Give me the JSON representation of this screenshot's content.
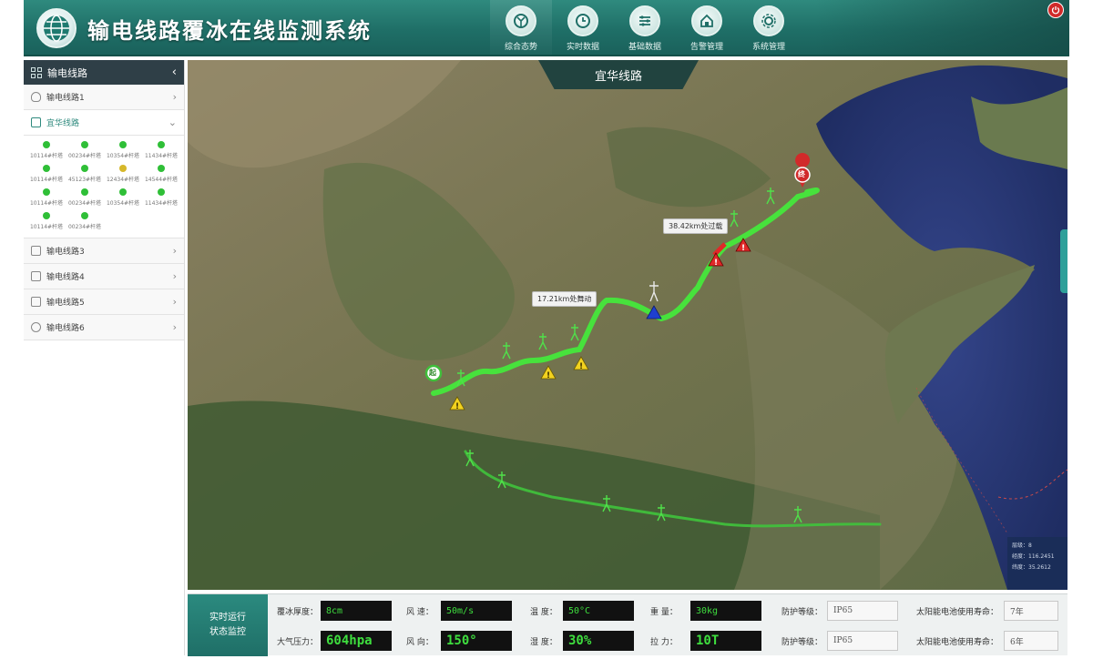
{
  "app": {
    "title": "输电线路覆冰在线监测系统"
  },
  "nav": [
    {
      "label": "综合态势",
      "icon": "dashboard-icon",
      "active": true
    },
    {
      "label": "实时数据",
      "icon": "realtime-data-icon",
      "active": false
    },
    {
      "label": "基础数据",
      "icon": "base-data-icon",
      "active": false
    },
    {
      "label": "告警管理",
      "icon": "alarm-house-icon",
      "active": false
    },
    {
      "label": "系统管理",
      "icon": "gear-icon",
      "active": false
    }
  ],
  "sidebar": {
    "header": "输电线路",
    "lines": [
      {
        "label": "输电线路1",
        "icon": "shield-icon"
      },
      {
        "label": "宜华线路",
        "icon": "calendar-icon",
        "expanded": true
      },
      {
        "label": "输电线路3",
        "icon": "calendar-icon"
      },
      {
        "label": "输电线路4",
        "icon": "document-icon"
      },
      {
        "label": "输电线路5",
        "icon": "document-icon"
      },
      {
        "label": "输电线路6",
        "icon": "share-icon"
      }
    ],
    "towers": [
      {
        "label": "10114#杆塔",
        "status": "normal"
      },
      {
        "label": "00234#杆塔",
        "status": "normal"
      },
      {
        "label": "10354#杆塔",
        "status": "normal"
      },
      {
        "label": "11434#杆塔",
        "status": "normal"
      },
      {
        "label": "10114#杆塔",
        "status": "normal"
      },
      {
        "label": "45123#杆塔",
        "status": "normal"
      },
      {
        "label": "12434#杆塔",
        "status": "warning"
      },
      {
        "label": "14544#杆塔",
        "status": "normal"
      },
      {
        "label": "10114#杆塔",
        "status": "normal"
      },
      {
        "label": "00234#杆塔",
        "status": "normal"
      },
      {
        "label": "10354#杆塔",
        "status": "normal"
      },
      {
        "label": "11434#杆塔",
        "status": "normal"
      },
      {
        "label": "10114#杆塔",
        "status": "normal"
      },
      {
        "label": "00234#杆塔",
        "status": "normal"
      }
    ]
  },
  "map": {
    "title": "宜华线路",
    "callouts": [
      "17.21km处舞动",
      "38.42km处过载"
    ],
    "start_marker": "起",
    "end_marker": "终",
    "coords": {
      "level": "层级：8",
      "lng": "经度：116.2451",
      "lat": "纬度：35.2612"
    }
  },
  "status_panel": {
    "title_line1": "实时运行",
    "title_line2": "状态监控",
    "row1": [
      {
        "label": "覆冰厚度：",
        "value": "8cm"
      },
      {
        "label": "风 速：",
        "value": "50m/s"
      },
      {
        "label": "温 度：",
        "value": "50°C"
      },
      {
        "label": "重 量：",
        "value": "30kg"
      },
      {
        "label": "防护等级：",
        "value": "IP65"
      },
      {
        "label": "太阳能电池使用寿命：",
        "value": "7年"
      }
    ],
    "row2": [
      {
        "label": "大气压力：",
        "value": "604hpa"
      },
      {
        "label": "风 向：",
        "value": "150°"
      },
      {
        "label": "湿 度：",
        "value": "30%"
      },
      {
        "label": "拉 力：",
        "value": "10T"
      },
      {
        "label": "防护等级：",
        "value": "IP65"
      },
      {
        "label": "太阳能电池使用寿命：",
        "value": "6年"
      }
    ]
  },
  "colors": {
    "brand": "#1f6f67",
    "alarm_red": "#d12a2a",
    "warning_yellow": "#e2c21c",
    "line_green": "#3ede3e"
  }
}
